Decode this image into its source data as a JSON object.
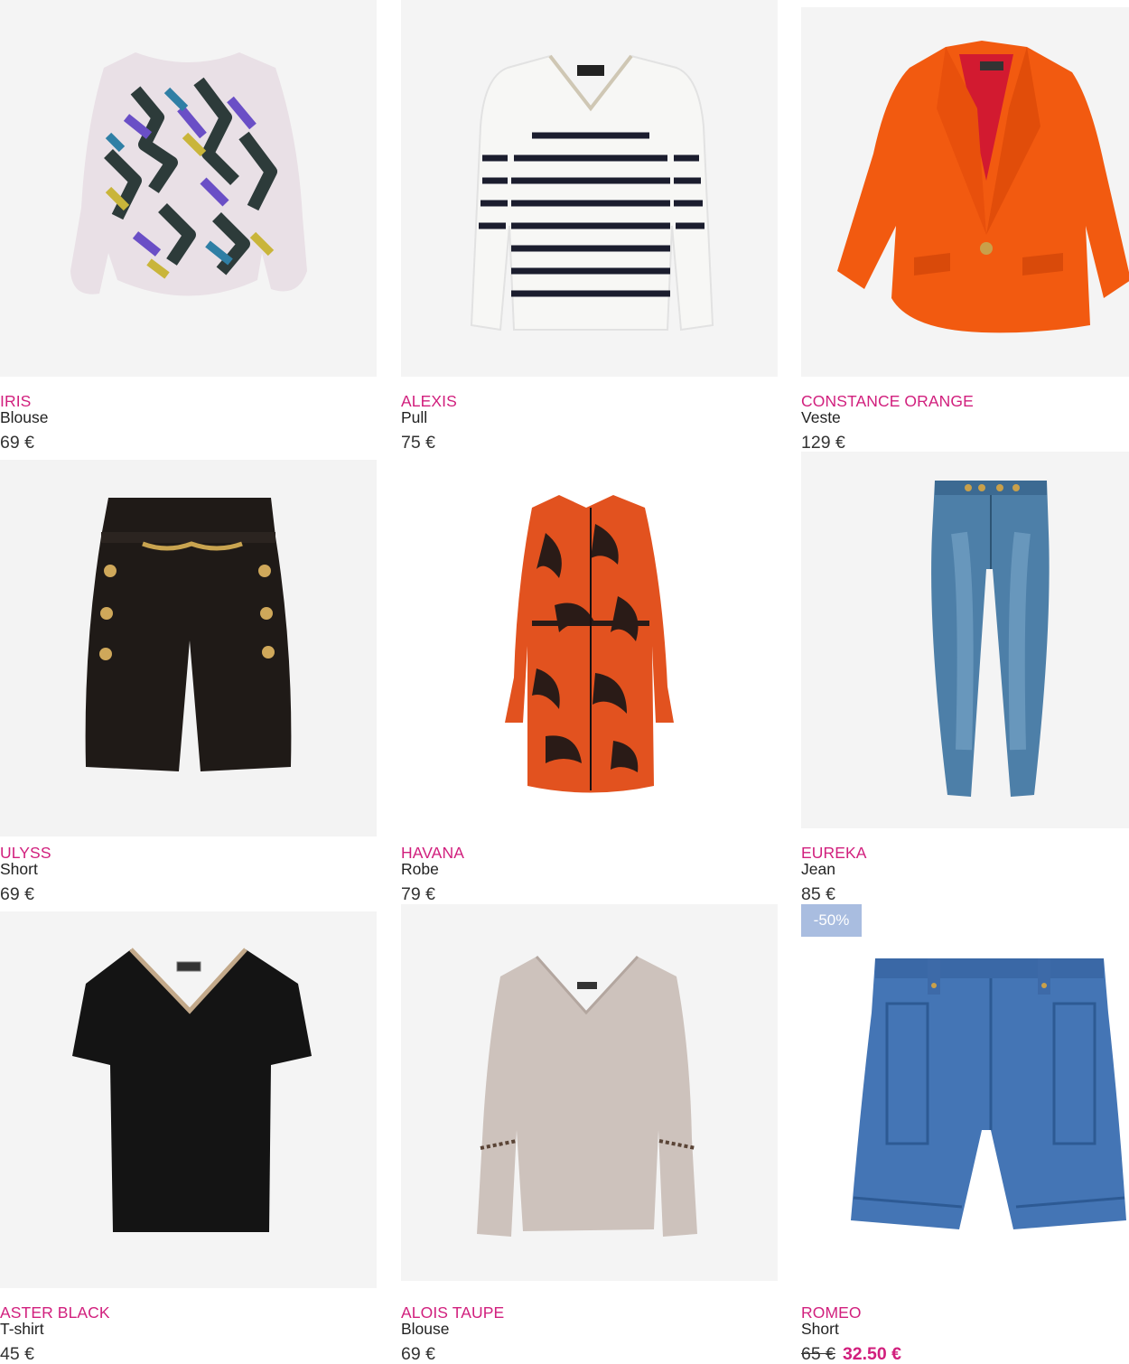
{
  "products": [
    {
      "name": "IRIS",
      "type": "Blouse",
      "price": "69 €"
    },
    {
      "name": "ALEXIS",
      "type": "Pull",
      "price": "75 €"
    },
    {
      "name": "CONSTANCE ORANGE",
      "type": "Veste",
      "price": "129 €"
    },
    {
      "name": "ULYSS",
      "type": "Short",
      "price": "69 €"
    },
    {
      "name": "HAVANA",
      "type": "Robe",
      "price": "79 €"
    },
    {
      "name": "EUREKA",
      "type": "Jean",
      "price": "85 €"
    },
    {
      "name": "ASTER BLACK",
      "type": "T-shirt",
      "price": "45 €"
    },
    {
      "name": "ALOIS TAUPE",
      "type": "Blouse",
      "price": "69 €"
    },
    {
      "name": "ROMEO",
      "type": "Short",
      "old_price": "65 €",
      "sale_price": "32.50 €",
      "badge": "-50%"
    }
  ],
  "colors": {
    "name_accent": "#d11f7d",
    "badge_bg": "#a9bde0",
    "photo_bg": "#f4f4f4"
  }
}
